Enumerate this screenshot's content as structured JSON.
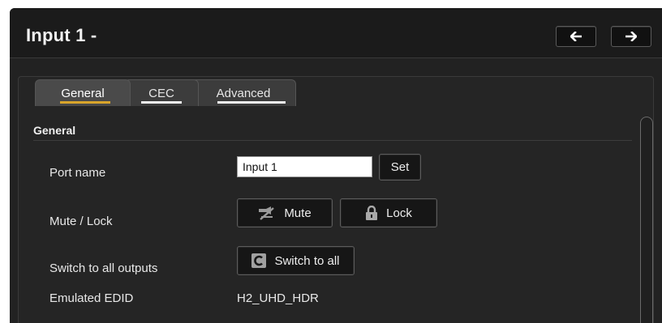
{
  "header": {
    "title": "Input 1 -",
    "prev_icon": "arrow-left-icon",
    "next_icon": "arrow-right-icon"
  },
  "tabs": [
    {
      "label": "General",
      "active": true
    },
    {
      "label": "CEC",
      "active": false
    },
    {
      "label": "Advanced",
      "active": false
    }
  ],
  "section": {
    "title": "General"
  },
  "port_name": {
    "label": "Port name",
    "value": "Input 1",
    "set_label": "Set"
  },
  "mute_lock": {
    "label": "Mute / Lock",
    "mute_label": "Mute",
    "mute_icon": "mute-icon",
    "lock_label": "Lock",
    "lock_icon": "lock-icon"
  },
  "switch_all": {
    "label": "Switch to all outputs",
    "button_label": "Switch to all",
    "icon": "switch-icon"
  },
  "edid": {
    "label": "Emulated EDID",
    "value": "H2_UHD_HDR"
  },
  "colors": {
    "panel_bg": "#222222",
    "active_tab_underline": "#d9a52b",
    "text": "#e8e8e8"
  }
}
